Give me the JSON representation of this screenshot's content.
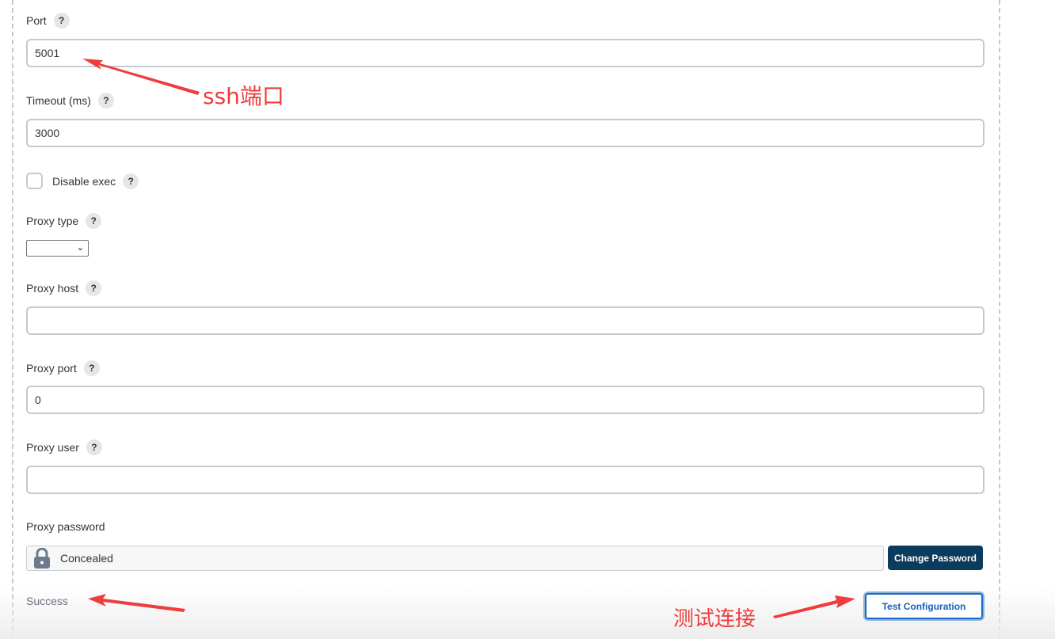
{
  "fields": {
    "port": {
      "label": "Port",
      "value": "5001"
    },
    "timeout": {
      "label": "Timeout (ms)",
      "value": "3000"
    },
    "disable_exec": {
      "label": "Disable exec",
      "checked": false
    },
    "proxy_type": {
      "label": "Proxy type",
      "selected": ""
    },
    "proxy_host": {
      "label": "Proxy host",
      "value": ""
    },
    "proxy_port": {
      "label": "Proxy port",
      "value": "0"
    },
    "proxy_user": {
      "label": "Proxy user",
      "value": ""
    },
    "proxy_password": {
      "label": "Proxy password",
      "concealed_text": "Concealed",
      "change_button": "Change Password"
    }
  },
  "help_glyph": "?",
  "status": {
    "text": "Success"
  },
  "test_button": "Test Configuration",
  "annotations": {
    "ssh_port": "ssh端口",
    "test_connection": "测试连接"
  },
  "colors": {
    "primary_dark": "#0b3c5d",
    "link_blue": "#1560bd",
    "annotation_red": "#ef3c3c"
  }
}
